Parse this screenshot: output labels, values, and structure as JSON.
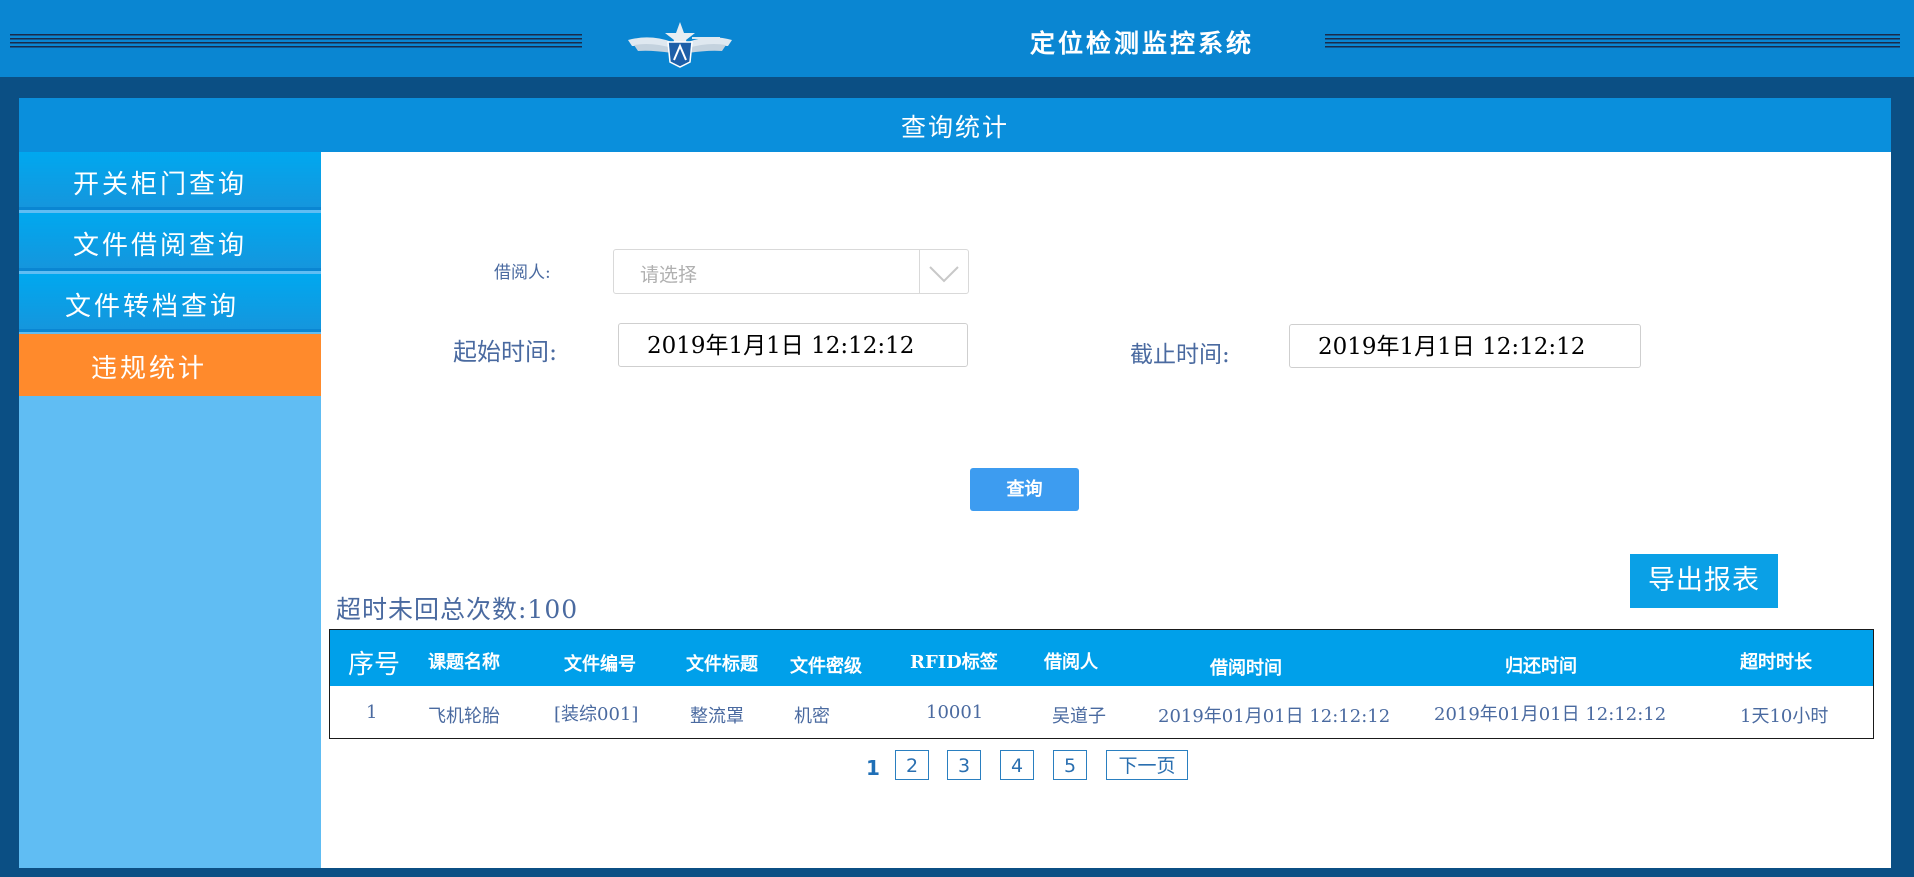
{
  "header": {
    "system_title": "定位检测监控系统",
    "logo": "winged-star-emblem"
  },
  "panel": {
    "title": "查询统计"
  },
  "sidebar": {
    "items": [
      {
        "label": "开关柜门查询",
        "active": false
      },
      {
        "label": "文件借阅查询",
        "active": false
      },
      {
        "label": "文件转档查询",
        "active": false
      },
      {
        "label": "违规统计",
        "active": true
      }
    ]
  },
  "filters": {
    "borrower_label": "借阅人:",
    "borrower_placeholder": "请选择",
    "start_label": "起始时间:",
    "start_value": "2019年1月1日  12:12:12",
    "end_label": "截止时间:",
    "end_value": "2019年1月1日  12:12:12",
    "query_button": "查询"
  },
  "export_button": "导出报表",
  "summary": "超时未回总次数:100",
  "table": {
    "columns": [
      "序号",
      "课题名称",
      "文件编号",
      "文件标题",
      "文件密级",
      "RFID标签",
      "借阅人",
      "借阅时间",
      "归还时间",
      "超时时长"
    ],
    "rows": [
      [
        "1",
        "飞机轮胎",
        "[装综001]",
        "整流罩",
        "机密",
        "10001",
        "吴道子",
        "2019年01月01日  12:12:12",
        "2019年01月01日  12:12:12",
        "1天10小时"
      ]
    ]
  },
  "pagination": {
    "current": "1",
    "pages": [
      "2",
      "3",
      "4",
      "5"
    ],
    "next": "下一页"
  },
  "colors": {
    "header_bg": "#0a86d2",
    "frame_bg": "#0b4f84",
    "accent_blue": "#00a0ea",
    "active_orange": "#ff8a2c",
    "sidebar_bg": "#60bdf3",
    "muted_text": "#4a6aa0"
  }
}
